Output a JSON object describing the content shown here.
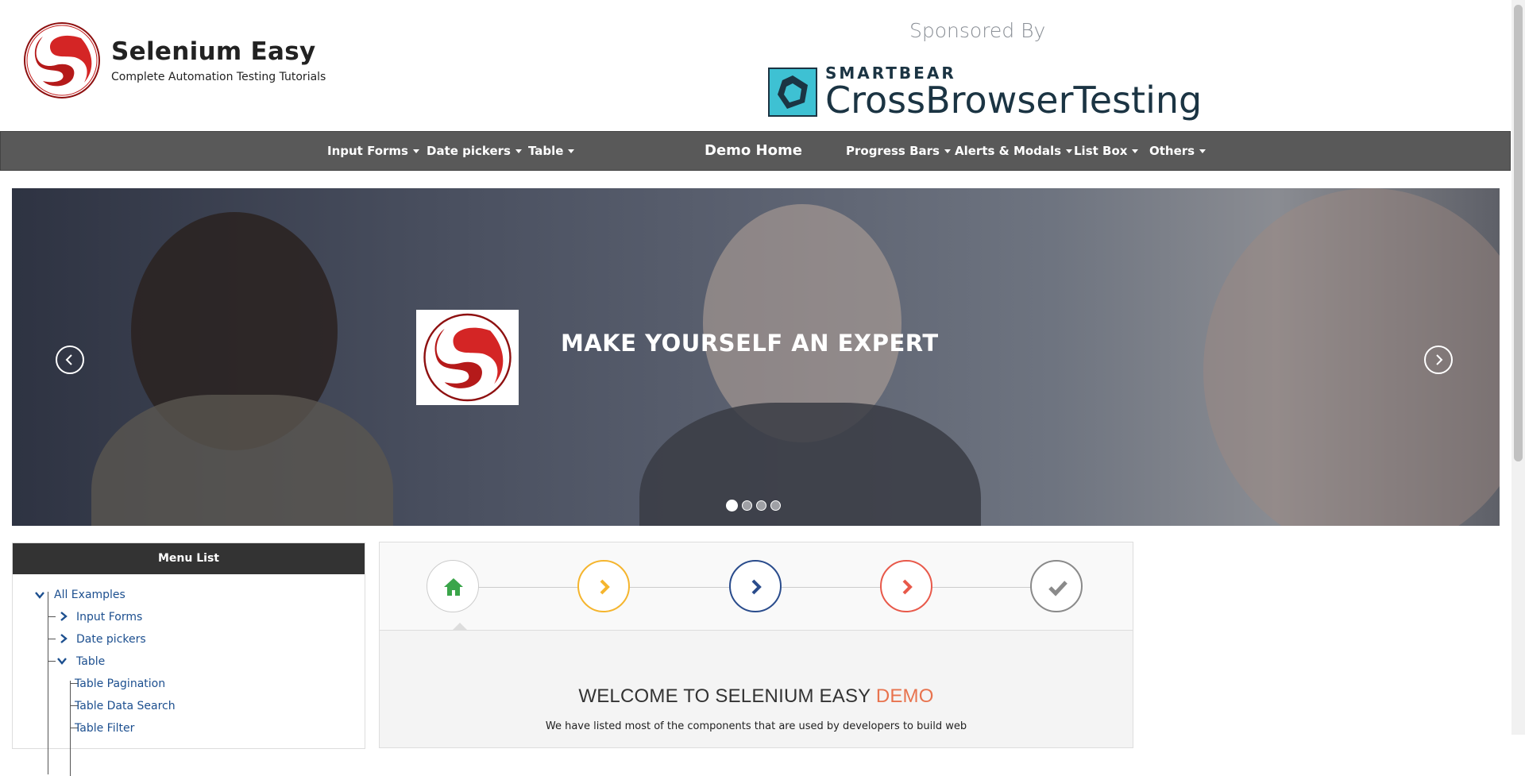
{
  "header": {
    "brand_title": "Selenium Easy",
    "brand_tagline": "Complete Automation Testing Tutorials",
    "sponsor_label": "Sponsored By",
    "sponsor_top": "SMARTBEAR",
    "sponsor_bottom": "CrossBrowserTesting"
  },
  "nav": {
    "input_forms": "Input Forms",
    "date_pickers": "Date pickers",
    "table": "Table",
    "demo_home": "Demo Home",
    "progress_bars": "Progress Bars",
    "alerts_modals": "Alerts & Modals",
    "list_box": "List Box",
    "others": "Others"
  },
  "carousel": {
    "headline": "MAKE YOURSELF AN EXPERT",
    "slide_count": 4,
    "active_slide": 1
  },
  "menu": {
    "title": "Menu List",
    "items": [
      {
        "label": "All Examples"
      },
      {
        "label": "Input Forms"
      },
      {
        "label": "Date pickers"
      },
      {
        "label": "Table"
      },
      {
        "label": "Table Pagination"
      },
      {
        "label": "Table Data Search"
      },
      {
        "label": "Table Filter"
      }
    ]
  },
  "main": {
    "welcome_prefix": "WELCOME TO SELENIUM EASY ",
    "welcome_accent": "DEMO",
    "description": "We have listed most of the components that are used by developers to build web"
  },
  "colors": {
    "navbar": "#595959",
    "step_home": "#3aa54a",
    "step_2": "#f5b52e",
    "step_3": "#2a4c8c",
    "step_4": "#e8594a",
    "step_5": "#8a8a8a",
    "accent": "#e8734e",
    "link": "#1c4f8f"
  }
}
